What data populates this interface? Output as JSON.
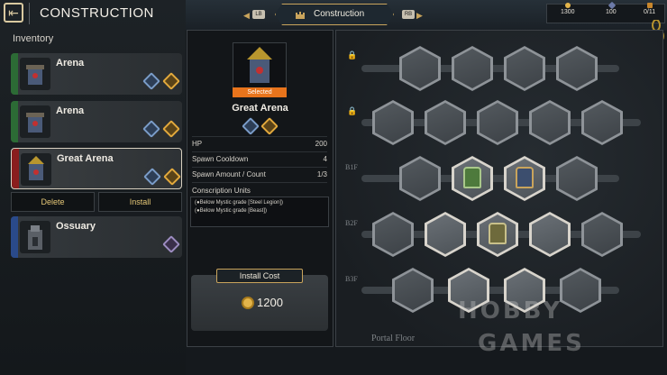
{
  "header": {
    "title": "CONSTRUCTION",
    "inventory_label": "Inventory"
  },
  "inventory": [
    {
      "name": "Arena",
      "color": "#2c6b35"
    },
    {
      "name": "Arena",
      "color": "#2c6b35"
    },
    {
      "name": "Great Arena",
      "color": "#8a1e1e"
    },
    {
      "name": "Ossuary",
      "color": "#2a4a8a"
    }
  ],
  "actions": {
    "delete": "Delete",
    "install": "Install"
  },
  "tabs": {
    "title": "Construction",
    "left_key": "LB",
    "right_key": "RB"
  },
  "resources": [
    {
      "icon": "gold-coin-icon",
      "value": "1300"
    },
    {
      "icon": "soul-gem-icon",
      "value": "100"
    },
    {
      "icon": "unit-count-icon",
      "value": "0/11"
    }
  ],
  "detail": {
    "name": "Great Arena",
    "badge": "Selected",
    "stats": [
      {
        "label": "HP",
        "value": "200"
      },
      {
        "label": "Spawn Cooldown",
        "value": "4"
      },
      {
        "label": "Spawn Amount / Count",
        "value": "1/3"
      }
    ],
    "conscription_title": "Conscription Units",
    "conscription": [
      "(●Below Mystic grade [Steel Legion])",
      "(●Below Mystic grade [Beast])"
    ],
    "install_cost_label": "Install Cost",
    "install_cost": "1200"
  },
  "map": {
    "floors": [
      "B1F",
      "B2F",
      "B3F"
    ],
    "portal_label": "Portal Floor"
  },
  "watermark": {
    "line1": "HOBBY",
    "line2": "GAMES"
  }
}
